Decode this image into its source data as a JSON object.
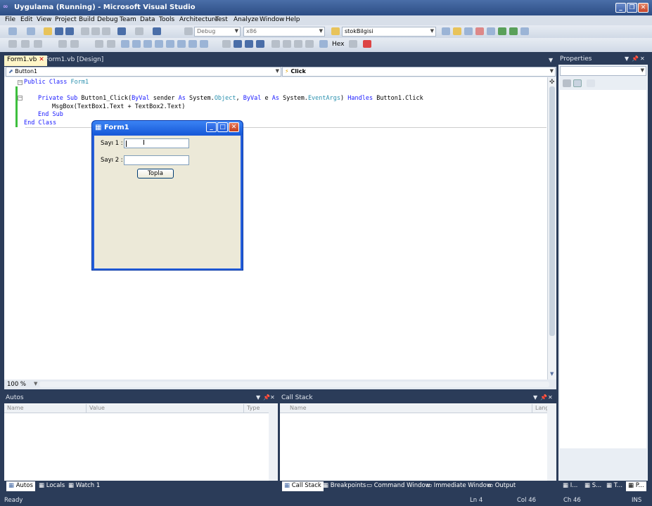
{
  "window": {
    "title": "Uygulama (Running) - Microsoft Visual Studio"
  },
  "menu": [
    "File",
    "Edit",
    "View",
    "Project",
    "Build",
    "Debug",
    "Team",
    "Data",
    "Tools",
    "Architecture",
    "Test",
    "Analyze",
    "Window",
    "Help"
  ],
  "toolbar": {
    "config": "Debug",
    "platform": "x86",
    "find_text": "stokBilgisi",
    "hex_label": "Hex"
  },
  "doc_tabs": [
    "Form1.vb",
    "Form1.vb [Design]"
  ],
  "nav": {
    "object": "Button1",
    "member": "Click"
  },
  "code": {
    "line1_kw": "Public Class",
    "line1_name": "Form1",
    "line2_kw1": "Private Sub",
    "line2_a": " Button1_Click(",
    "line2_kw2": "ByVal",
    "line2_b": " sender ",
    "line2_kw3": "As",
    "line2_c": " System.",
    "line2_ty1": "Object",
    "line2_d": ", ",
    "line2_kw4": "ByVal",
    "line2_e": " e ",
    "line2_kw5": "As",
    "line2_f": " System.",
    "line2_ty2": "EventArgs",
    "line2_g": ") ",
    "line2_kw6": "Handles",
    "line2_h": " Button1.Click",
    "line3": "MsgBox(TextBox1.Text + TextBox2.Text)",
    "line4": "End Sub",
    "line5": "End Class"
  },
  "zoom": "100 %",
  "properties": {
    "title": "Properties"
  },
  "form": {
    "title": "Form1",
    "label1": "Sayı 1 :",
    "label2": "Sayı 2 :",
    "button": "Topla"
  },
  "autos": {
    "title": "Autos",
    "cols": [
      "Name",
      "Value",
      "Type"
    ]
  },
  "callstack": {
    "title": "Call Stack",
    "cols": [
      "Name",
      "Lang"
    ]
  },
  "bottom_tabs_left": [
    "Autos",
    "Locals",
    "Watch 1"
  ],
  "bottom_tabs_right": [
    "Call Stack",
    "Breakpoints",
    "Command Window",
    "Immediate Window",
    "Output"
  ],
  "right_tabs": [
    "I...",
    "S...",
    "T...",
    "P..."
  ],
  "status": {
    "text": "Ready",
    "ln": "Ln 4",
    "col": "Col 46",
    "ch": "Ch 46",
    "mode": "INS"
  }
}
